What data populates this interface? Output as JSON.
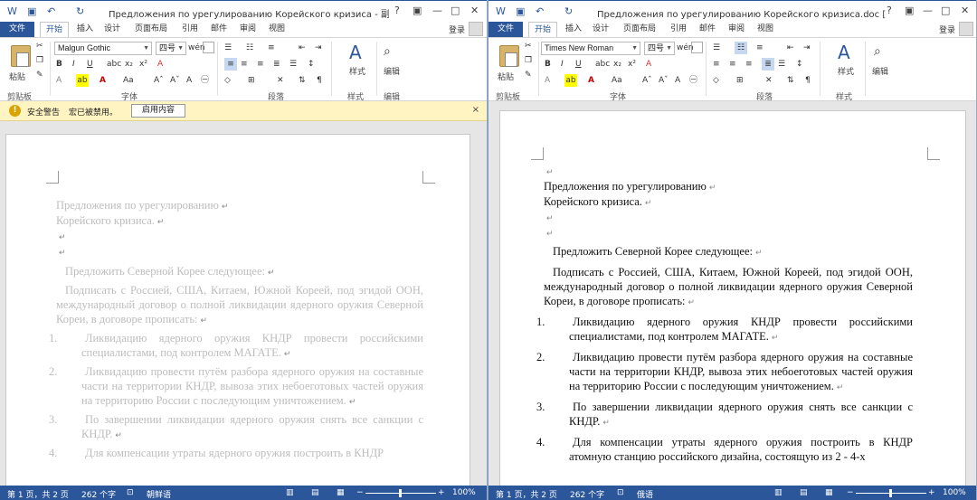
{
  "left": {
    "title": "Предложения по урегулированию Корейского кризиса - 副本...",
    "tabs": [
      "文件",
      "开始",
      "插入",
      "设计",
      "页面布局",
      "引用",
      "邮件",
      "审阅",
      "视图"
    ],
    "login": "登录",
    "ribbon": {
      "paste_label": "粘贴",
      "font_name": "Malgun Gothic",
      "font_size": "四号",
      "groups": [
        "剪贴板",
        "字体",
        "段落",
        "样式",
        "编辑"
      ],
      "styles_label": "样式",
      "edit_label": "编辑"
    },
    "security": {
      "title": "安全警告",
      "message": "宏已被禁用。",
      "button": "启用内容",
      "close": "×"
    },
    "doc": {
      "title1": "Предложения по урегулированию",
      "title2": "Корейского кризиса.",
      "intro": "Предложить Северной Корее следующее:",
      "para1": "Подписать с Россией, США, Китаем, Южной Кореей, под эгидой ООН, международный договор о полной ликвидации ядерного оружия Северной Кореи, в договоре прописать:",
      "items": [
        {
          "n": "1.",
          "text": "Ликвидацию ядерного оружия КНДР провести российскими специалистами, под контролем МАГАТЕ."
        },
        {
          "n": "2.",
          "text": "Ликвидацию провести путём разбора ядерного оружия на составные части на территории КНДР, вывоза этих небоеготовых частей оружия на территорию России с последующим уничтожением."
        },
        {
          "n": "3.",
          "text": "По завершении ликвидации ядерного оружия снять все санкции с КНДР."
        },
        {
          "n": "4.",
          "text": "Для компенсации утраты ядерного оружия построить в КНДР"
        }
      ]
    },
    "status": {
      "page": "第 1 页，共 2 页",
      "words": "262 个字",
      "lang": "朝鲜语",
      "zoom": "100%"
    }
  },
  "right": {
    "title": "Предложения по урегулированию Корейского кризиса.doc [兼...",
    "tabs": [
      "文件",
      "开始",
      "插入",
      "设计",
      "页面布局",
      "引用",
      "邮件",
      "审阅",
      "视图"
    ],
    "login": "登录",
    "ribbon": {
      "paste_label": "粘贴",
      "font_name": "Times New Roman",
      "font_size": "四号",
      "groups": [
        "剪贴板",
        "字体",
        "段落",
        "样式"
      ],
      "styles_label": "样式",
      "edit_label": "编辑"
    },
    "doc": {
      "title1": "Предложения по урегулированию",
      "title2": "Корейского кризиса.",
      "intro": "Предложить Северной Корее следующее:",
      "para1": "Подписать с Россией, США, Китаем, Южной Кореей, под эгидой ООН, международный договор о полной ликвидации ядерного оружия Северной Кореи, в договоре прописать:",
      "items": [
        {
          "n": "1.",
          "text": "Ликвидацию ядерного оружия КНДР провести российскими специалистами, под контролем МАГАТЕ."
        },
        {
          "n": "2.",
          "text": "Ликвидацию провести путём разбора ядерного оружия на составные части на территории КНДР, вывоза этих небоеготовых частей оружия на территорию России с последующим уничтожением."
        },
        {
          "n": "3.",
          "text": "По завершении ликвидации ядерного оружия снять все санкции с КНДР."
        },
        {
          "n": "4.",
          "text": "Для компенсации утраты ядерного оружия построить в КНДР атомную станцию российского дизайна, состоящую из 2 - 4-х"
        }
      ]
    },
    "status": {
      "page": "第 1 页，共 2 页",
      "words": "262 个字",
      "lang": "俄语",
      "zoom": "100%"
    }
  },
  "colors": {
    "accent": "#2b579a",
    "warning_bar": "#fff4c2"
  }
}
